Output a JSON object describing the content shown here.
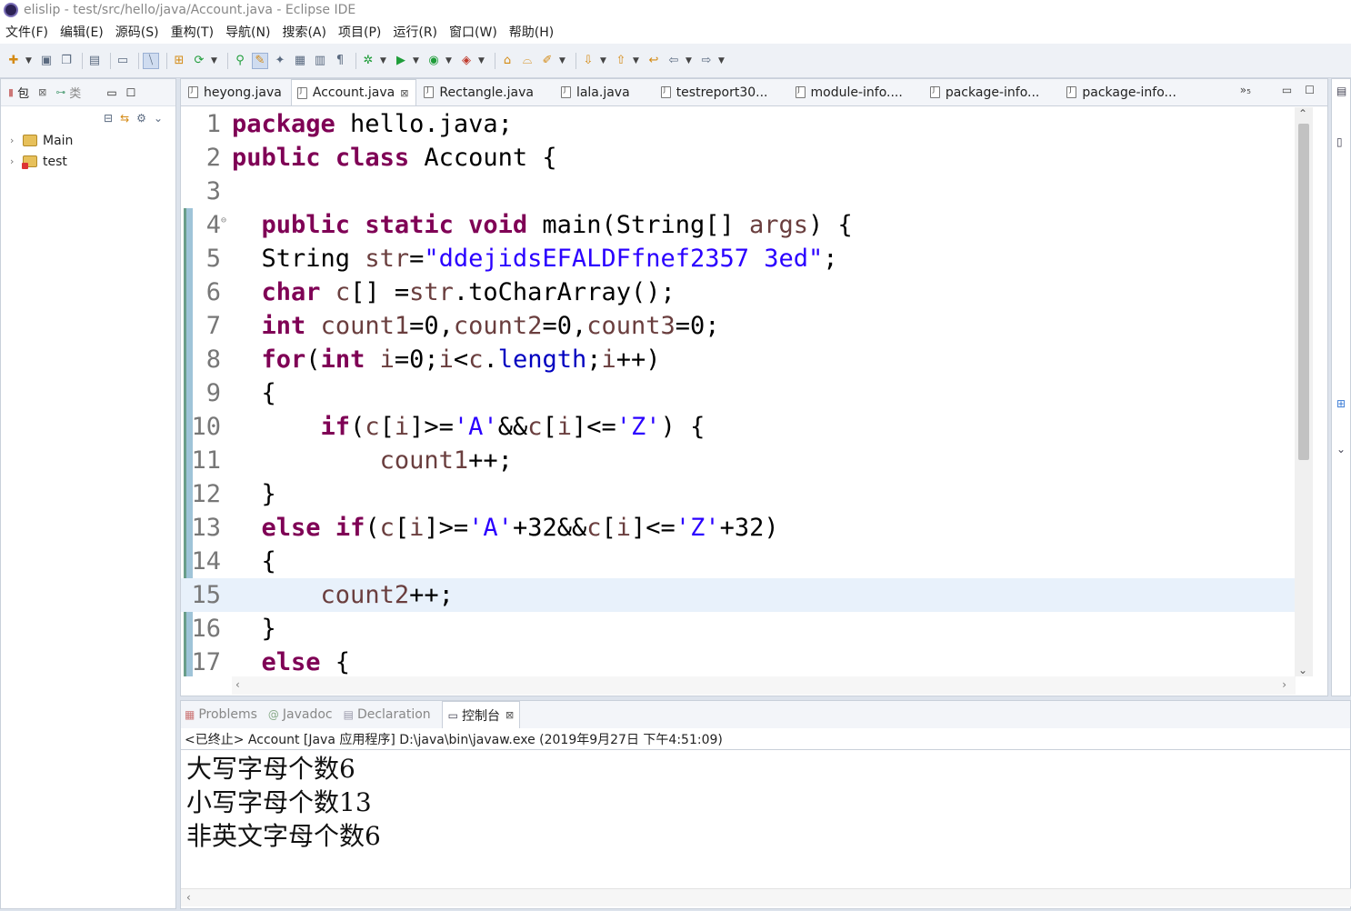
{
  "window": {
    "title": "elislip - test/src/hello/java/Account.java - Eclipse IDE"
  },
  "menu": [
    "文件(F)",
    "编辑(E)",
    "源码(S)",
    "重构(T)",
    "导航(N)",
    "搜索(A)",
    "项目(P)",
    "运行(R)",
    "窗口(W)",
    "帮助(H)"
  ],
  "left_panel": {
    "tab_package": "包",
    "tab_package_close": "⊠",
    "tab_class": "类",
    "tree": [
      {
        "label": "Main"
      },
      {
        "label": "test"
      }
    ]
  },
  "editor": {
    "tabs": [
      {
        "label": "heyong.java",
        "active": false
      },
      {
        "label": "Account.java",
        "active": true
      },
      {
        "label": "Rectangle.java",
        "active": false
      },
      {
        "label": "lala.java",
        "active": false
      },
      {
        "label": "testreport30...",
        "active": false
      },
      {
        "label": "module-info....",
        "active": false
      },
      {
        "label": "package-info...",
        "active": false
      },
      {
        "label": "package-info...",
        "active": false
      }
    ],
    "overflow_label": "»₅",
    "current_line": 15
  },
  "console": {
    "tabs": {
      "problems": "Problems",
      "javadoc": "Javadoc",
      "declaration": "Declaration",
      "console": "控制台"
    },
    "status": "<已终止> Account [Java 应用程序] D:\\java\\bin\\javaw.exe  (2019年9月27日 下午4:51:09)",
    "output": [
      "大写字母个数6",
      "小写字母个数13",
      "非英文字母个数6"
    ]
  },
  "colors": {
    "keyword": "#7f0055",
    "string": "#2a00ff",
    "field": "#0000c0",
    "variable": "#6a3e3e",
    "current_line_bg": "#e8f1fb"
  }
}
